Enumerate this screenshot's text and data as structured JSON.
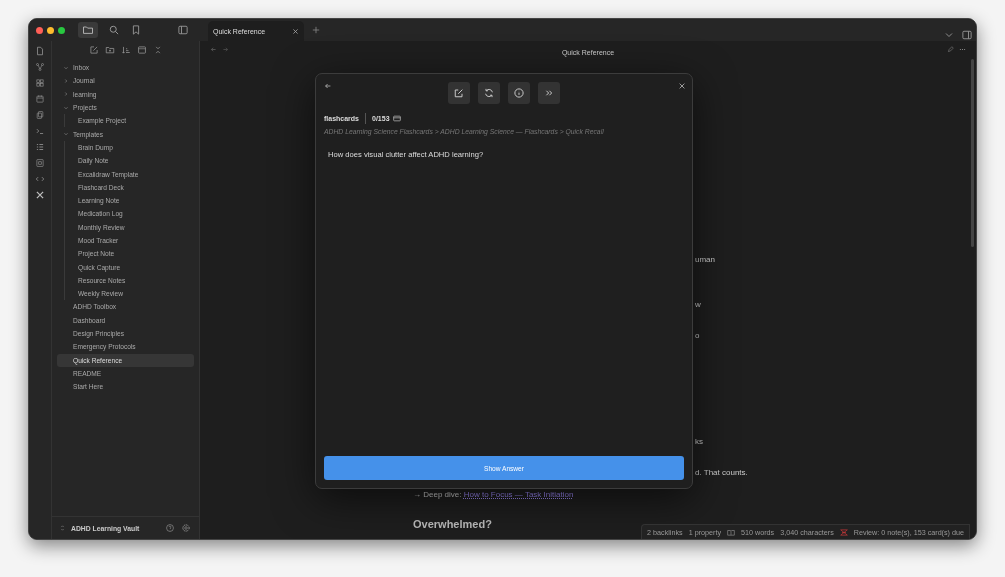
{
  "tabs": [
    {
      "label": "Quick Reference",
      "selected": true
    }
  ],
  "sidebar": {
    "items": [
      {
        "label": "Inbox",
        "kind": "folder",
        "expanded": true,
        "selected": false
      },
      {
        "label": "Journal",
        "kind": "folder",
        "expanded": false,
        "selected": false
      },
      {
        "label": "learning",
        "kind": "folder",
        "expanded": false,
        "selected": false
      },
      {
        "label": "Projects",
        "kind": "folder",
        "expanded": true,
        "selected": false,
        "children": [
          {
            "label": "Example Project",
            "selected": false
          }
        ]
      },
      {
        "label": "Templates",
        "kind": "folder",
        "expanded": true,
        "selected": false,
        "children": [
          {
            "label": "Brain Dump",
            "selected": false
          },
          {
            "label": "Daily Note",
            "selected": false
          },
          {
            "label": "Excalidraw Template",
            "selected": false
          },
          {
            "label": "Flashcard Deck",
            "selected": false
          },
          {
            "label": "Learning Note",
            "selected": false
          },
          {
            "label": "Medication Log",
            "selected": false
          },
          {
            "label": "Monthly Review",
            "selected": false
          },
          {
            "label": "Mood Tracker",
            "selected": false
          },
          {
            "label": "Project Note",
            "selected": false
          },
          {
            "label": "Quick Capture",
            "selected": false
          },
          {
            "label": "Resource Notes",
            "selected": false
          },
          {
            "label": "Weekly Review",
            "selected": false
          }
        ]
      },
      {
        "label": "ADHD Toolbox",
        "kind": "file",
        "selected": false
      },
      {
        "label": "Dashboard",
        "kind": "file",
        "selected": false
      },
      {
        "label": "Design Principles",
        "kind": "file",
        "selected": false
      },
      {
        "label": "Emergency Protocols",
        "kind": "file",
        "selected": false
      },
      {
        "label": "Quick Reference",
        "kind": "file",
        "selected": true
      },
      {
        "label": "README",
        "kind": "file",
        "selected": false
      },
      {
        "label": "Start Here",
        "kind": "file",
        "selected": false
      }
    ],
    "vault": "ADHD Learning Vault"
  },
  "note": {
    "title": "Quick Reference",
    "fragments": [
      "uman",
      "w",
      "o",
      "ks",
      "d. That counts."
    ],
    "deep_dive": {
      "prefix": "→ Deep dive: ",
      "link": "How to Focus — Task Initiation"
    },
    "heading": "Overwhelmed?"
  },
  "flashcard": {
    "deck": "flashcards",
    "count": "0/153",
    "breadcrumb": "ADHD Learning Science Flashcards > ADHD Learning Science — Flashcards > Quick Recall",
    "question": "How does visual clutter affect ADHD learning?",
    "button": "Show Answer"
  },
  "status_bar": {
    "backlinks": "2 backlinks",
    "properties": "1 property",
    "words": "510 words",
    "characters": "3,040 characters",
    "review": "Review: 0 note(s), 153 card(s) due"
  }
}
